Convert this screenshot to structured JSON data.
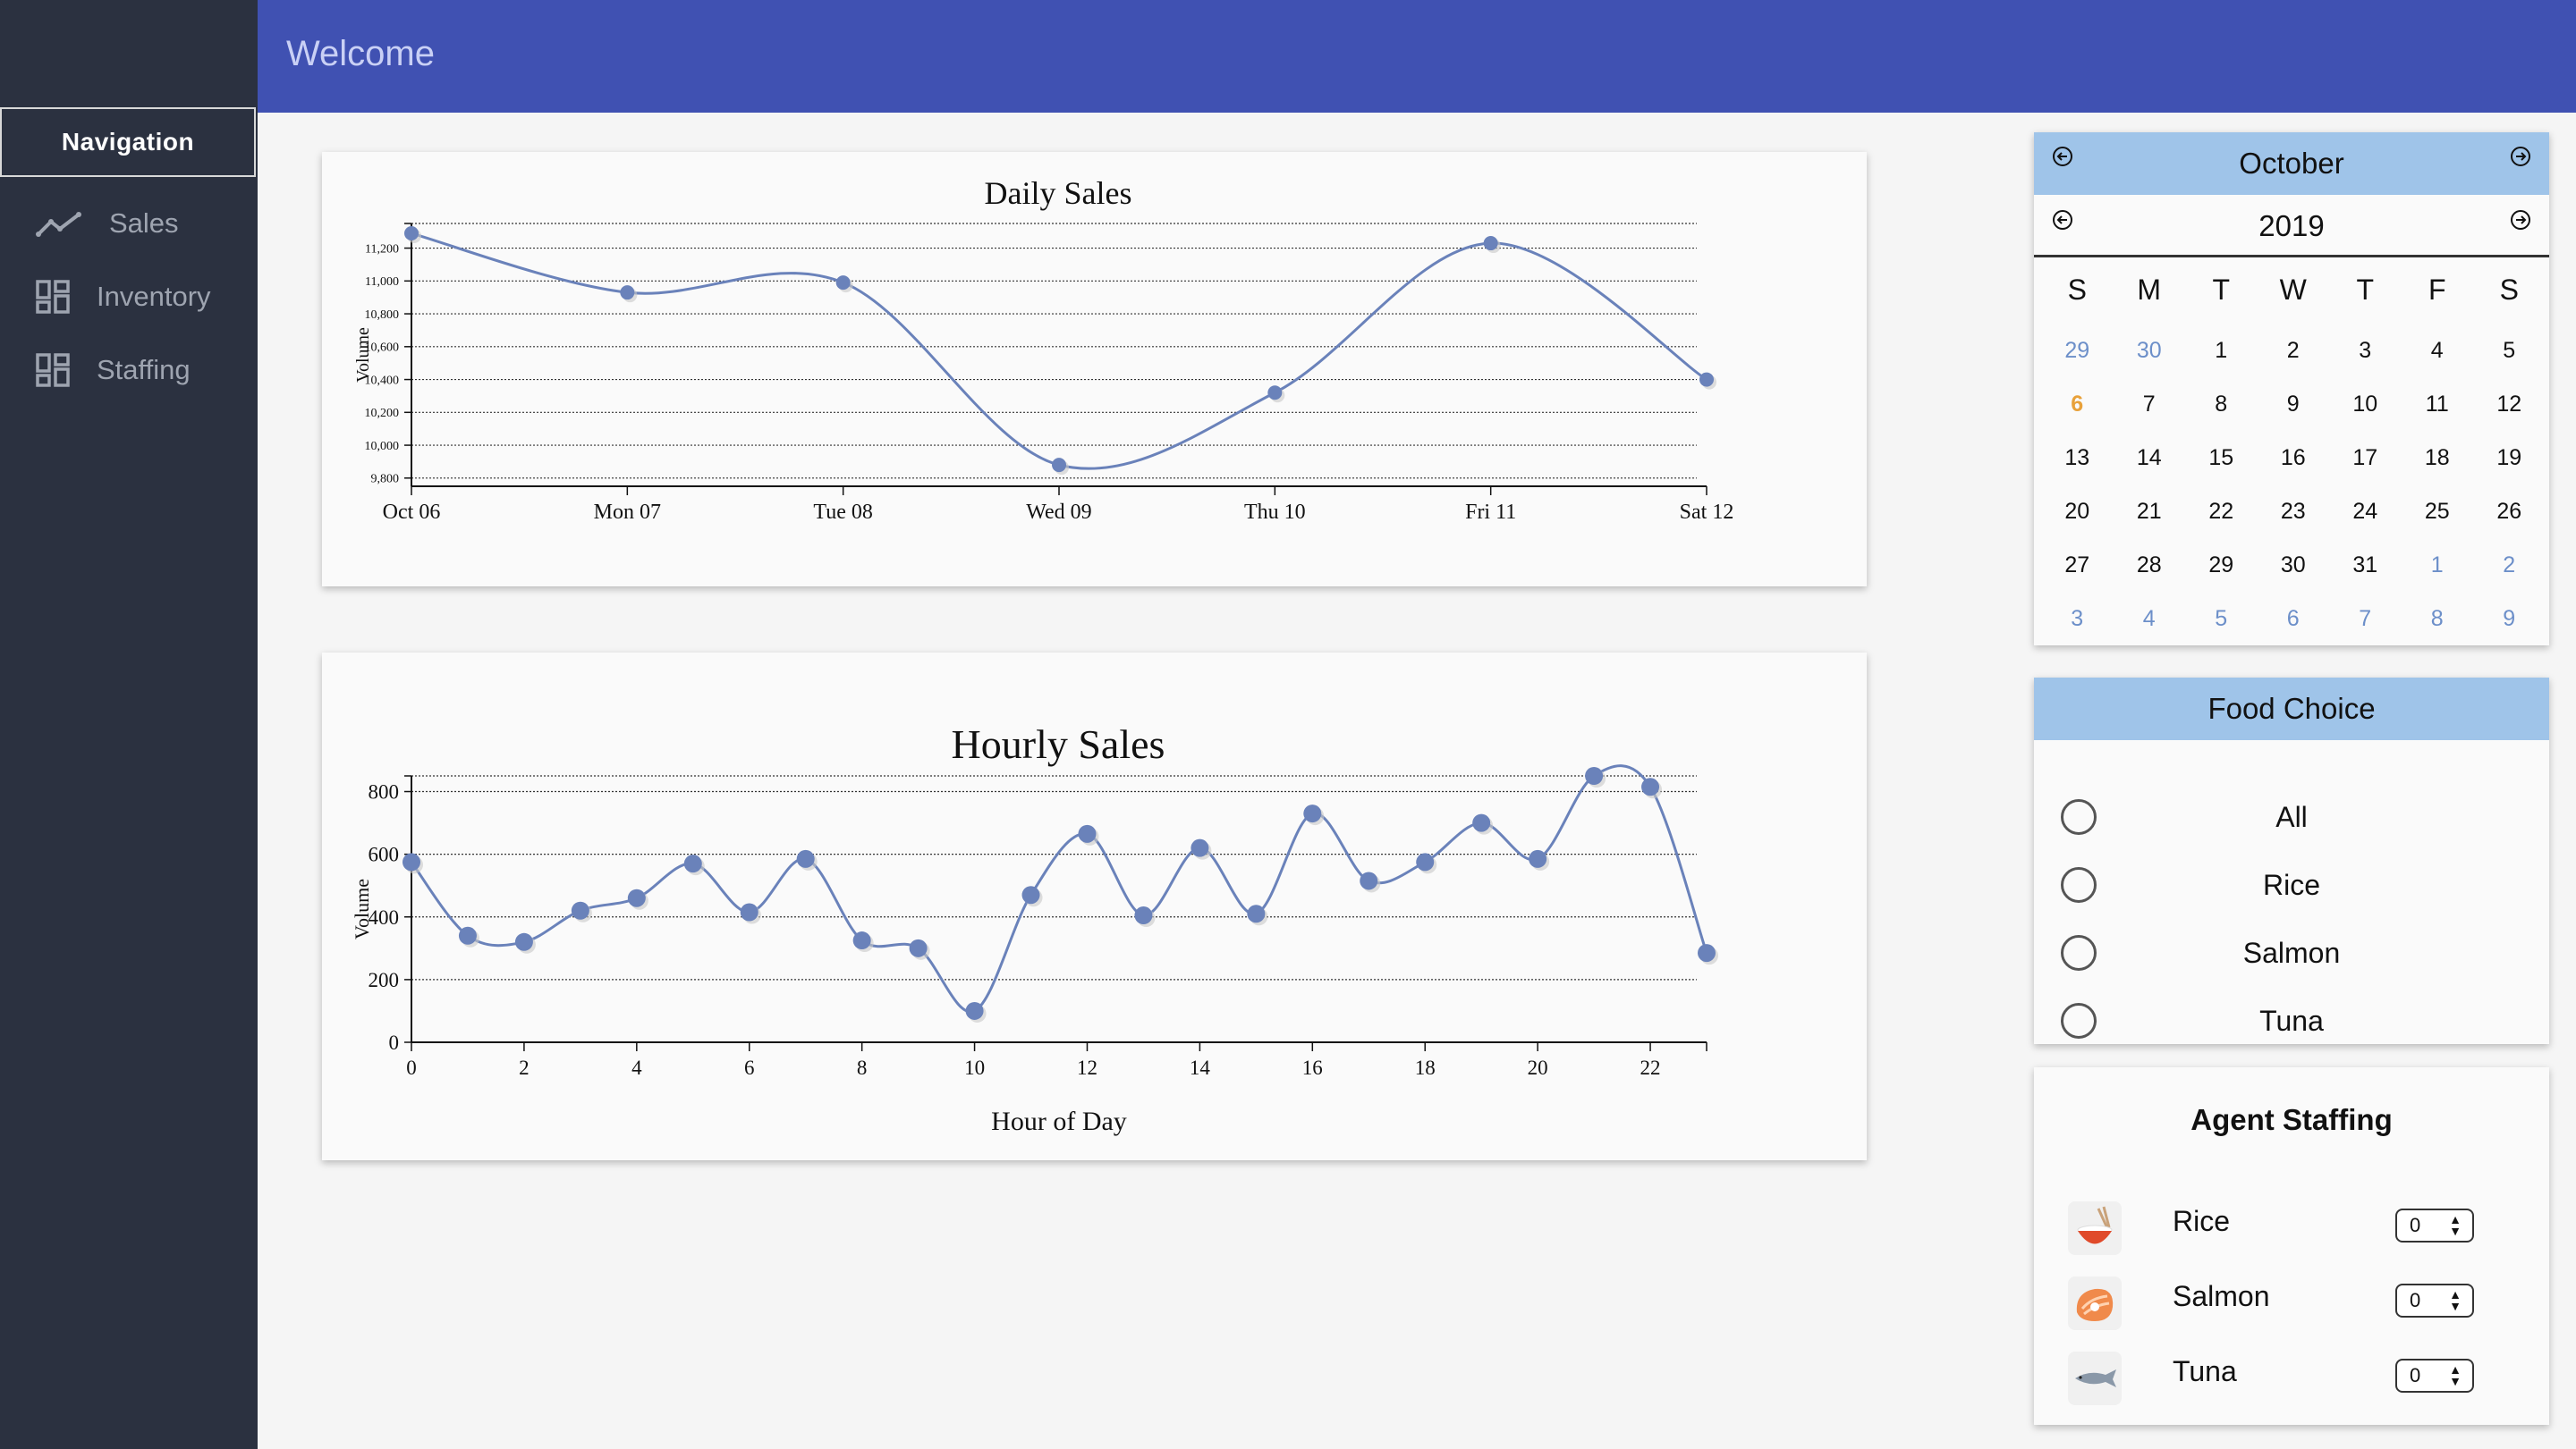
{
  "header": {
    "title": "Welcome"
  },
  "sidebar": {
    "heading": "Navigation",
    "items": [
      {
        "label": "Sales",
        "icon": "trend-line-icon"
      },
      {
        "label": "Inventory",
        "icon": "dashboard-grid-icon"
      },
      {
        "label": "Staffing",
        "icon": "dashboard-grid-icon"
      }
    ]
  },
  "colors": {
    "topbar": "#4051b2",
    "sidebar": "#2b3140",
    "accent": "#9fc4e9",
    "series": "#6a82ba",
    "today": "#e8a13a"
  },
  "charts": [
    {
      "type": "line",
      "title": "Daily Sales",
      "ylabel": "Volume",
      "xlabel": "",
      "categories": [
        "Oct 06",
        "Mon 07",
        "Tue 08",
        "Wed 09",
        "Thu 10",
        "Fri 11",
        "Sat 12"
      ],
      "values": [
        11290,
        10930,
        10990,
        9880,
        10320,
        11230,
        10400
      ],
      "ylim": [
        9750,
        11350
      ],
      "yticks": [
        9800,
        10000,
        10200,
        10400,
        10600,
        10800,
        11000,
        11200
      ],
      "ytick_labels": [
        "9,800",
        "10,000",
        "10,200",
        "10,400",
        "10,600",
        "10,800",
        "11,000",
        "11,200"
      ],
      "grid": true
    },
    {
      "type": "line",
      "title": "Hourly Sales",
      "ylabel": "Volume",
      "xlabel": "Hour of Day",
      "x": [
        0,
        1,
        2,
        3,
        4,
        5,
        6,
        7,
        8,
        9,
        10,
        11,
        12,
        13,
        14,
        15,
        16,
        17,
        18,
        19,
        20,
        21,
        22,
        23
      ],
      "values": [
        575,
        340,
        320,
        420,
        460,
        570,
        415,
        585,
        325,
        300,
        100,
        470,
        665,
        405,
        620,
        410,
        730,
        515,
        575,
        700,
        585,
        850,
        815,
        285
      ],
      "xlim": [
        0,
        23
      ],
      "ylim": [
        0,
        850
      ],
      "xticks": [
        0,
        2,
        4,
        6,
        8,
        10,
        12,
        14,
        16,
        18,
        20,
        22
      ],
      "yticks": [
        0,
        200,
        400,
        600,
        800
      ],
      "grid": true
    }
  ],
  "chart_data": [
    {
      "type": "line",
      "title": "Daily Sales",
      "ylabel": "Volume",
      "categories": [
        "Oct 06",
        "Mon 07",
        "Tue 08",
        "Wed 09",
        "Thu 10",
        "Fri 11",
        "Sat 12"
      ],
      "values": [
        11290,
        10930,
        10990,
        9880,
        10320,
        11230,
        10400
      ],
      "ylim": [
        9750,
        11350
      ],
      "grid": true
    },
    {
      "type": "line",
      "title": "Hourly Sales",
      "xlabel": "Hour of Day",
      "ylabel": "Volume",
      "x": [
        0,
        1,
        2,
        3,
        4,
        5,
        6,
        7,
        8,
        9,
        10,
        11,
        12,
        13,
        14,
        15,
        16,
        17,
        18,
        19,
        20,
        21,
        22,
        23
      ],
      "values": [
        575,
        340,
        320,
        420,
        460,
        570,
        415,
        585,
        325,
        300,
        100,
        470,
        665,
        405,
        620,
        410,
        730,
        515,
        575,
        700,
        585,
        850,
        815,
        285
      ],
      "ylim": [
        0,
        850
      ],
      "grid": true
    }
  ],
  "calendar": {
    "month": "October",
    "year": "2019",
    "weekdays": [
      "S",
      "M",
      "T",
      "W",
      "T",
      "F",
      "S"
    ],
    "weeks": [
      [
        {
          "d": "29",
          "o": true
        },
        {
          "d": "30",
          "o": true
        },
        {
          "d": "1"
        },
        {
          "d": "2"
        },
        {
          "d": "3"
        },
        {
          "d": "4"
        },
        {
          "d": "5"
        }
      ],
      [
        {
          "d": "6",
          "today": true
        },
        {
          "d": "7"
        },
        {
          "d": "8"
        },
        {
          "d": "9"
        },
        {
          "d": "10"
        },
        {
          "d": "11"
        },
        {
          "d": "12"
        }
      ],
      [
        {
          "d": "13"
        },
        {
          "d": "14"
        },
        {
          "d": "15"
        },
        {
          "d": "16"
        },
        {
          "d": "17"
        },
        {
          "d": "18"
        },
        {
          "d": "19"
        }
      ],
      [
        {
          "d": "20"
        },
        {
          "d": "21"
        },
        {
          "d": "22"
        },
        {
          "d": "23"
        },
        {
          "d": "24"
        },
        {
          "d": "25"
        },
        {
          "d": "26"
        }
      ],
      [
        {
          "d": "27"
        },
        {
          "d": "28"
        },
        {
          "d": "29"
        },
        {
          "d": "30"
        },
        {
          "d": "31"
        },
        {
          "d": "1",
          "o": true
        },
        {
          "d": "2",
          "o": true
        }
      ],
      [
        {
          "d": "3",
          "o": true
        },
        {
          "d": "4",
          "o": true
        },
        {
          "d": "5",
          "o": true
        },
        {
          "d": "6",
          "o": true
        },
        {
          "d": "7",
          "o": true
        },
        {
          "d": "8",
          "o": true
        },
        {
          "d": "9",
          "o": true
        }
      ]
    ]
  },
  "food": {
    "title": "Food Choice",
    "options": [
      "All",
      "Rice",
      "Salmon",
      "Tuna"
    ]
  },
  "staffing": {
    "title": "Agent Staffing",
    "rows": [
      {
        "label": "Rice",
        "value": "0",
        "icon": "rice-bowl-icon"
      },
      {
        "label": "Salmon",
        "value": "0",
        "icon": "salmon-steak-icon"
      },
      {
        "label": "Tuna",
        "value": "0",
        "icon": "tuna-fish-icon"
      }
    ]
  }
}
